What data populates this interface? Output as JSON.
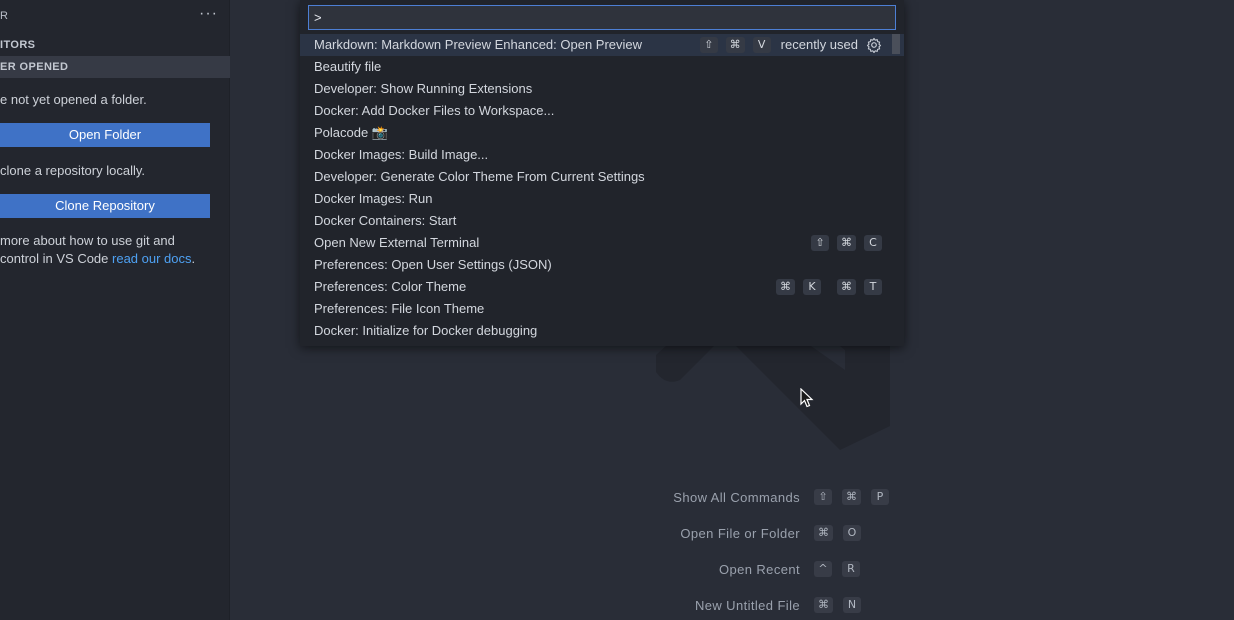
{
  "sidebar": {
    "header_title": "R",
    "more_label": "···",
    "section_editors": "ITORS",
    "section_explorer": "ER OPENED",
    "no_folder_text": "e not yet opened a folder.",
    "open_folder_button": "Open Folder",
    "clone_text": " clone a repository locally.",
    "clone_button": "Clone Repository",
    "learn_line1": " more about how to use git and",
    "learn_line2_prefix": "control in VS Code ",
    "learn_link": "read our docs",
    "learn_suffix": "."
  },
  "command_palette": {
    "input_value": ">",
    "items": [
      {
        "label": "Markdown: Markdown Preview Enhanced: Open Preview",
        "keys": [
          "⇧",
          "⌘",
          "V"
        ],
        "badge": "recently used",
        "active": true
      },
      {
        "label": "Beautify file"
      },
      {
        "label": "Developer: Show Running Extensions"
      },
      {
        "label": "Docker: Add Docker Files to Workspace..."
      },
      {
        "label": "Polacode 📸"
      },
      {
        "label": "Docker Images: Build Image..."
      },
      {
        "label": "Developer: Generate Color Theme From Current Settings"
      },
      {
        "label": "Docker Images: Run"
      },
      {
        "label": "Docker Containers: Start"
      },
      {
        "label": "Open New External Terminal",
        "keys": [
          "⇧",
          "⌘",
          "C"
        ]
      },
      {
        "label": "Preferences: Open User Settings (JSON)"
      },
      {
        "label": "Preferences: Color Theme",
        "keys": [
          "⌘",
          "K",
          "⌘",
          "T"
        ]
      },
      {
        "label": "Preferences: File Icon Theme"
      },
      {
        "label": "Docker: Initialize for Docker debugging"
      }
    ]
  },
  "shortcuts": [
    {
      "label": "Show All Commands",
      "keys": [
        "⇧",
        "⌘",
        "P"
      ]
    },
    {
      "label": "Open File or Folder",
      "keys": [
        "⌘",
        "O"
      ]
    },
    {
      "label": "Open Recent",
      "keys": [
        "^",
        "R"
      ]
    },
    {
      "label": "New Untitled File",
      "keys": [
        "⌘",
        "N"
      ]
    }
  ],
  "icons": {
    "gear": "gear-icon",
    "more": "ellipsis-icon",
    "watermark": "vscode-logo-icon",
    "cursor": "mouse-pointer-icon"
  },
  "colors": {
    "accent": "#3f72c6",
    "focus_border": "#4d7fd4",
    "link": "#4ea1f3",
    "editor_bg": "#292d37",
    "sidebar_bg": "#23262e",
    "palette_bg": "#21242b"
  }
}
